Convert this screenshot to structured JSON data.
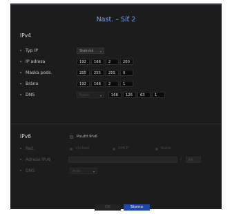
{
  "dialog": {
    "title": "Nast. – Síť 2"
  },
  "ipv4": {
    "heading": "IPv4",
    "type_label": "Typ IP",
    "type_value": "Statická",
    "ip_label": "IP adresa",
    "ip": [
      "192",
      "168",
      "2",
      "200"
    ],
    "mask_label": "Maska pods.",
    "mask": [
      "255",
      "255",
      "255",
      "0"
    ],
    "gateway_label": "Brána",
    "gateway": [
      "192",
      "168",
      "2",
      "1"
    ],
    "dns_label": "DNS",
    "dns_mode": "Ruční",
    "dns": [
      "168",
      "126",
      "63",
      "1"
    ]
  },
  "ipv6": {
    "heading": "IPv6",
    "use_label": "Použít IPv6",
    "use_checked": false,
    "mode_label": "Rež.",
    "modes": [
      "Výchozí",
      "DHCP",
      "Ruční"
    ],
    "address_label": "Adresa IPv6",
    "address_value": "",
    "prefix": "64",
    "dns_label": "DNS",
    "dns_value": "Auto"
  },
  "buttons": {
    "ok": "OK",
    "cancel": "Storno"
  },
  "colors": {
    "title": "#7fa5f0",
    "cancel_bg": "#1e47a8",
    "background": "#1c1c1c"
  }
}
